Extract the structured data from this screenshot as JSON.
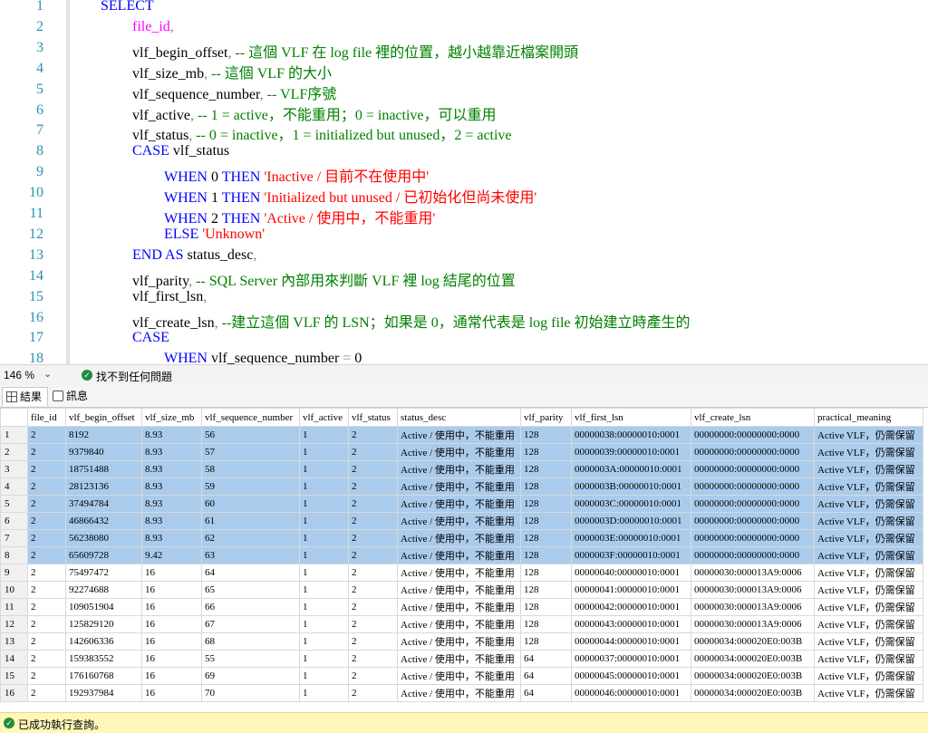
{
  "editor": {
    "line_numbers": [
      "1",
      "2",
      "3",
      "4",
      "5",
      "6",
      "7",
      "8",
      "9",
      "10",
      "11",
      "12",
      "13",
      "14",
      "15",
      "16",
      "17",
      "18"
    ],
    "lines": [
      {
        "indent": 1,
        "tokens": [
          {
            "c": "kw",
            "t": "SELECT"
          }
        ]
      },
      {
        "indent": 2,
        "tokens": [
          {
            "c": "fn",
            "t": "file_id"
          },
          {
            "c": "op",
            "t": ","
          }
        ]
      },
      {
        "indent": 2,
        "tokens": [
          {
            "c": "",
            "t": "vlf_begin_offset"
          },
          {
            "c": "op",
            "t": ","
          },
          {
            "c": "cm",
            "t": " -- 這個 VLF 在 log file 裡的位置，越小越靠近檔案開頭"
          }
        ]
      },
      {
        "indent": 2,
        "tokens": [
          {
            "c": "",
            "t": "vlf_size_mb"
          },
          {
            "c": "op",
            "t": ","
          },
          {
            "c": "cm",
            "t": " -- 這個 VLF 的大小"
          }
        ]
      },
      {
        "indent": 2,
        "tokens": [
          {
            "c": "",
            "t": "vlf_sequence_number"
          },
          {
            "c": "op",
            "t": ","
          },
          {
            "c": "cm",
            "t": " -- VLF序號"
          }
        ]
      },
      {
        "indent": 2,
        "tokens": [
          {
            "c": "",
            "t": "vlf_active"
          },
          {
            "c": "op",
            "t": ","
          },
          {
            "c": "cm",
            "t": " -- 1 = active，不能重用；0 = inactive，可以重用"
          }
        ]
      },
      {
        "indent": 2,
        "tokens": [
          {
            "c": "",
            "t": "vlf_status"
          },
          {
            "c": "op",
            "t": ","
          },
          {
            "c": "cm",
            "t": " -- 0 = inactive，1 = initialized but unused，2 = active"
          }
        ]
      },
      {
        "indent": 2,
        "tokens": [
          {
            "c": "kw",
            "t": "CASE"
          },
          {
            "c": "",
            "t": " vlf_status"
          }
        ]
      },
      {
        "indent": 3,
        "tokens": [
          {
            "c": "kw",
            "t": "WHEN"
          },
          {
            "c": "",
            "t": " 0 "
          },
          {
            "c": "kw",
            "t": "THEN"
          },
          {
            "c": "st",
            "t": " 'Inactive / 目前不在使用中'"
          }
        ]
      },
      {
        "indent": 3,
        "tokens": [
          {
            "c": "kw",
            "t": "WHEN"
          },
          {
            "c": "",
            "t": " 1 "
          },
          {
            "c": "kw",
            "t": "THEN"
          },
          {
            "c": "st",
            "t": " 'Initialized but unused / 已初始化但尚未使用'"
          }
        ]
      },
      {
        "indent": 3,
        "tokens": [
          {
            "c": "kw",
            "t": "WHEN"
          },
          {
            "c": "",
            "t": " 2 "
          },
          {
            "c": "kw",
            "t": "THEN"
          },
          {
            "c": "st",
            "t": " 'Active / 使用中，不能重用'"
          }
        ]
      },
      {
        "indent": 3,
        "tokens": [
          {
            "c": "kw",
            "t": "ELSE"
          },
          {
            "c": "st",
            "t": " 'Unknown'"
          }
        ]
      },
      {
        "indent": 2,
        "tokens": [
          {
            "c": "kw",
            "t": "END"
          },
          {
            "c": "",
            "t": " "
          },
          {
            "c": "kw",
            "t": "AS"
          },
          {
            "c": "",
            "t": " status_desc"
          },
          {
            "c": "op",
            "t": ","
          }
        ]
      },
      {
        "indent": 2,
        "tokens": [
          {
            "c": "",
            "t": "vlf_parity"
          },
          {
            "c": "op",
            "t": ","
          },
          {
            "c": "cm",
            "t": " -- SQL Server 內部用來判斷 VLF 裡 log 結尾的位置"
          }
        ]
      },
      {
        "indent": 2,
        "tokens": [
          {
            "c": "",
            "t": "vlf_first_lsn"
          },
          {
            "c": "op",
            "t": ","
          }
        ]
      },
      {
        "indent": 2,
        "tokens": [
          {
            "c": "",
            "t": "vlf_create_lsn"
          },
          {
            "c": "op",
            "t": ","
          },
          {
            "c": "cm",
            "t": " --建立這個 VLF 的 LSN；如果是 0，通常代表是 log file 初始建立時產生的"
          }
        ]
      },
      {
        "indent": 2,
        "tokens": [
          {
            "c": "kw",
            "t": "CASE"
          }
        ]
      },
      {
        "indent": 3,
        "tokens": [
          {
            "c": "kw",
            "t": "WHEN"
          },
          {
            "c": "",
            "t": " vlf_sequence_number "
          },
          {
            "c": "op",
            "t": "="
          },
          {
            "c": "",
            "t": " 0"
          }
        ]
      }
    ]
  },
  "editor_status": {
    "zoom": "146 %",
    "issues": "找不到任何問題"
  },
  "tabs": {
    "results": "結果",
    "messages": "訊息"
  },
  "grid": {
    "columns": [
      "",
      "file_id",
      "vlf_begin_offset",
      "vlf_size_mb",
      "vlf_sequence_number",
      "vlf_active",
      "vlf_status",
      "status_desc",
      "vlf_parity",
      "vlf_first_lsn",
      "vlf_create_lsn",
      "practical_meaning"
    ],
    "selected_rows": 8,
    "rows": [
      [
        "1",
        "2",
        "8192",
        "8.93",
        "56",
        "1",
        "2",
        "Active / 使用中，不能重用",
        "128",
        "00000038:00000010:0001",
        "00000000:00000000:0000",
        "Active VLF，仍需保留"
      ],
      [
        "2",
        "2",
        "9379840",
        "8.93",
        "57",
        "1",
        "2",
        "Active / 使用中，不能重用",
        "128",
        "00000039:00000010:0001",
        "00000000:00000000:0000",
        "Active VLF，仍需保留"
      ],
      [
        "3",
        "2",
        "18751488",
        "8.93",
        "58",
        "1",
        "2",
        "Active / 使用中，不能重用",
        "128",
        "0000003A:00000010:0001",
        "00000000:00000000:0000",
        "Active VLF，仍需保留"
      ],
      [
        "4",
        "2",
        "28123136",
        "8.93",
        "59",
        "1",
        "2",
        "Active / 使用中，不能重用",
        "128",
        "0000003B:00000010:0001",
        "00000000:00000000:0000",
        "Active VLF，仍需保留"
      ],
      [
        "5",
        "2",
        "37494784",
        "8.93",
        "60",
        "1",
        "2",
        "Active / 使用中，不能重用",
        "128",
        "0000003C:00000010:0001",
        "00000000:00000000:0000",
        "Active VLF，仍需保留"
      ],
      [
        "6",
        "2",
        "46866432",
        "8.93",
        "61",
        "1",
        "2",
        "Active / 使用中，不能重用",
        "128",
        "0000003D:00000010:0001",
        "00000000:00000000:0000",
        "Active VLF，仍需保留"
      ],
      [
        "7",
        "2",
        "56238080",
        "8.93",
        "62",
        "1",
        "2",
        "Active / 使用中，不能重用",
        "128",
        "0000003E:00000010:0001",
        "00000000:00000000:0000",
        "Active VLF，仍需保留"
      ],
      [
        "8",
        "2",
        "65609728",
        "9.42",
        "63",
        "1",
        "2",
        "Active / 使用中，不能重用",
        "128",
        "0000003F:00000010:0001",
        "00000000:00000000:0000",
        "Active VLF，仍需保留"
      ],
      [
        "9",
        "2",
        "75497472",
        "16",
        "64",
        "1",
        "2",
        "Active / 使用中，不能重用",
        "128",
        "00000040:00000010:0001",
        "00000030:000013A9:0006",
        "Active VLF，仍需保留"
      ],
      [
        "10",
        "2",
        "92274688",
        "16",
        "65",
        "1",
        "2",
        "Active / 使用中，不能重用",
        "128",
        "00000041:00000010:0001",
        "00000030:000013A9:0006",
        "Active VLF，仍需保留"
      ],
      [
        "11",
        "2",
        "109051904",
        "16",
        "66",
        "1",
        "2",
        "Active / 使用中，不能重用",
        "128",
        "00000042:00000010:0001",
        "00000030:000013A9:0006",
        "Active VLF，仍需保留"
      ],
      [
        "12",
        "2",
        "125829120",
        "16",
        "67",
        "1",
        "2",
        "Active / 使用中，不能重用",
        "128",
        "00000043:00000010:0001",
        "00000030:000013A9:0006",
        "Active VLF，仍需保留"
      ],
      [
        "13",
        "2",
        "142606336",
        "16",
        "68",
        "1",
        "2",
        "Active / 使用中，不能重用",
        "128",
        "00000044:00000010:0001",
        "00000034:000020E0:003B",
        "Active VLF，仍需保留"
      ],
      [
        "14",
        "2",
        "159383552",
        "16",
        "55",
        "1",
        "2",
        "Active / 使用中，不能重用",
        "64",
        "00000037:00000010:0001",
        "00000034:000020E0:003B",
        "Active VLF，仍需保留"
      ],
      [
        "15",
        "2",
        "176160768",
        "16",
        "69",
        "1",
        "2",
        "Active / 使用中，不能重用",
        "64",
        "00000045:00000010:0001",
        "00000034:000020E0:003B",
        "Active VLF，仍需保留"
      ],
      [
        "16",
        "2",
        "192937984",
        "16",
        "70",
        "1",
        "2",
        "Active / 使用中，不能重用",
        "64",
        "00000046:00000010:0001",
        "00000034:000020E0:003B",
        "Active VLF，仍需保留"
      ]
    ]
  },
  "status_bar": {
    "message": "已成功執行查詢。"
  }
}
